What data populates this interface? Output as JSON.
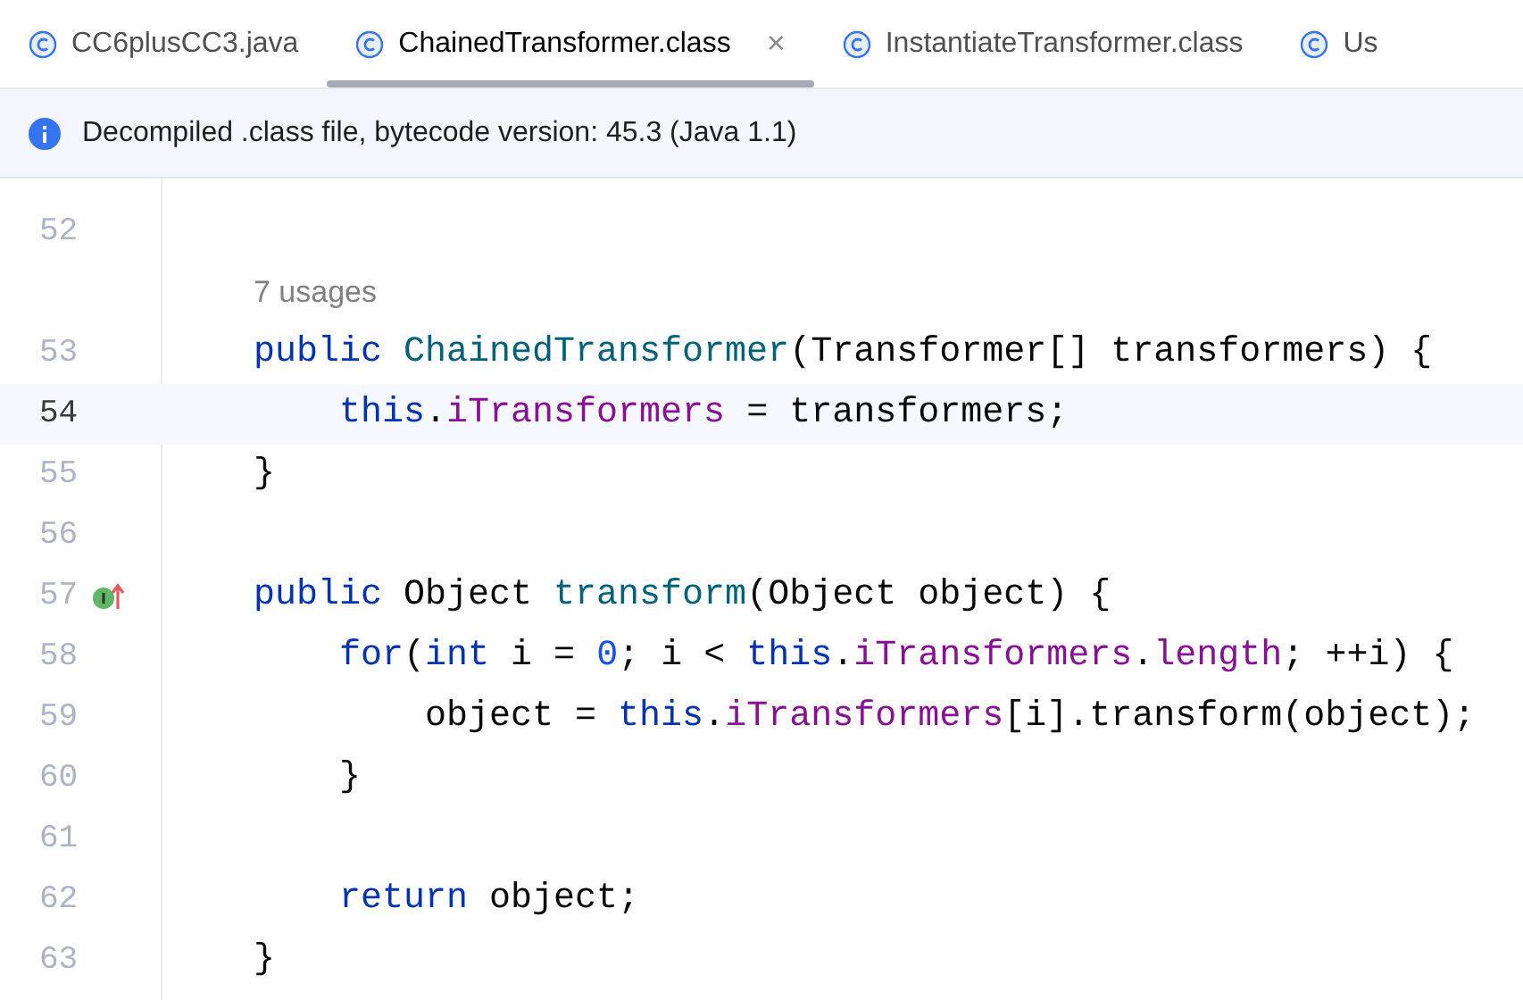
{
  "tabs": [
    {
      "label": "CC6plusCC3.java",
      "selected": false
    },
    {
      "label": "ChainedTransformer.class",
      "selected": true
    },
    {
      "label": "InstantiateTransformer.class",
      "selected": false
    },
    {
      "label": "Us",
      "selected": false
    }
  ],
  "close_glyph": "×",
  "banner": {
    "text": "Decompiled .class file, bytecode version: 45.3 (Java 1.1)"
  },
  "lines": [
    {
      "kind": "code",
      "number": "52",
      "current": false
    },
    {
      "kind": "hint",
      "text": "7 usages"
    },
    {
      "kind": "code",
      "number": "53",
      "current": false,
      "tokens": [
        {
          "kind": "keyword",
          "text": "public "
        },
        {
          "kind": "method",
          "text": "ChainedTransformer"
        },
        {
          "kind": "plain",
          "text": "(Transformer[] transformers) {"
        }
      ],
      "children": [
        {
          "kind": "code",
          "number": "54",
          "current": true,
          "tokens": [
            {
              "kind": "keyword",
              "text": "this"
            },
            {
              "kind": "plain",
              "text": "."
            },
            {
              "kind": "field",
              "text": "iTransformers"
            },
            {
              "kind": "plain",
              "text": " = transformers;"
            }
          ]
        }
      ]
    },
    {
      "kind": "code",
      "number": "55",
      "current": false,
      "tokens": [
        {
          "kind": "plain",
          "text": "}"
        }
      ]
    },
    {
      "kind": "code",
      "number": "56",
      "current": false
    },
    {
      "kind": "code",
      "number": "57",
      "current": false,
      "overrides": true,
      "tokens": [
        {
          "kind": "keyword",
          "text": "public "
        },
        {
          "kind": "plain",
          "text": "Object "
        },
        {
          "kind": "method",
          "text": "transform"
        },
        {
          "kind": "plain",
          "text": "(Object object) {"
        }
      ],
      "children": [
        {
          "kind": "code",
          "number": "58",
          "current": false,
          "tokens": [
            {
              "kind": "keyword",
              "text": "for"
            },
            {
              "kind": "plain",
              "text": "("
            },
            {
              "kind": "keyword",
              "text": "int"
            },
            {
              "kind": "plain",
              "text": " i = "
            },
            {
              "kind": "number",
              "text": "0"
            },
            {
              "kind": "plain",
              "text": "; i < "
            },
            {
              "kind": "keyword",
              "text": "this"
            },
            {
              "kind": "plain",
              "text": "."
            },
            {
              "kind": "field",
              "text": "iTransformers"
            },
            {
              "kind": "plain",
              "text": "."
            },
            {
              "kind": "field",
              "text": "length"
            },
            {
              "kind": "plain",
              "text": "; ++i) {"
            }
          ],
          "children": [
            {
              "kind": "code",
              "number": "59",
              "current": false,
              "tokens": [
                {
                  "kind": "plain",
                  "text": "object = "
                },
                {
                  "kind": "keyword",
                  "text": "this"
                },
                {
                  "kind": "plain",
                  "text": "."
                },
                {
                  "kind": "field",
                  "text": "iTransformers"
                },
                {
                  "kind": "plain",
                  "text": "[i].transform(object);"
                }
              ]
            }
          ]
        },
        {
          "kind": "code",
          "number": "60",
          "current": false,
          "tokens": [
            {
              "kind": "plain",
              "text": "}"
            }
          ]
        },
        {
          "kind": "code",
          "number": "61",
          "current": false
        },
        {
          "kind": "code",
          "number": "62",
          "current": false,
          "tokens": [
            {
              "kind": "keyword",
              "text": "return"
            },
            {
              "kind": "plain",
              "text": " object;"
            }
          ]
        }
      ]
    },
    {
      "kind": "code",
      "number": "63",
      "current": false,
      "tokens": [
        {
          "kind": "plain",
          "text": "}"
        }
      ]
    }
  ]
}
